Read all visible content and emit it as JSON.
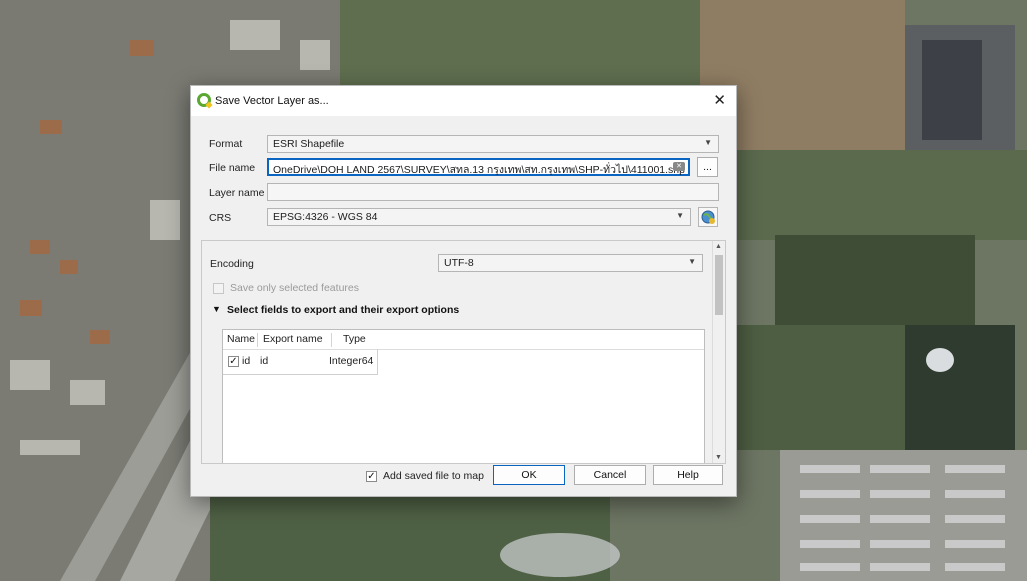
{
  "dialog": {
    "title": "Save Vector Layer as...",
    "close_glyph": "✕",
    "app_icon": "qgis-icon"
  },
  "form": {
    "format_label": "Format",
    "format_value": "ESRI Shapefile",
    "filename_label": "File name",
    "filename_value": "OneDrive\\DOH LAND 2567\\SURVEY\\สทล.13 กรุงเทพ\\สท.กรุงเทพ\\SHP-ทั่วไป\\411001.shp",
    "filename_browse": "...",
    "layername_label": "Layer name",
    "layername_value": "",
    "crs_label": "CRS",
    "crs_value": "EPSG:4326 - WGS 84"
  },
  "options": {
    "encoding_label": "Encoding",
    "encoding_value": "UTF-8",
    "save_selected_label": "Save only selected features",
    "save_selected_checked": false,
    "fields_section_title": "Select fields to export and their export options",
    "fields_section_arrow": "▼",
    "table_headers": [
      "Name",
      "Export name",
      "Type"
    ],
    "fields": [
      {
        "checked": true,
        "name": "id",
        "export_name": "id",
        "type": "Integer64"
      }
    ]
  },
  "footer": {
    "add_to_map_label": "Add saved file to map",
    "add_to_map_checked": true,
    "ok_label": "OK",
    "cancel_label": "Cancel",
    "help_label": "Help"
  },
  "colors": {
    "accent": "#0a64c2",
    "dialog_bg": "#f0f0f0",
    "qgis_green": "#5aa832"
  }
}
